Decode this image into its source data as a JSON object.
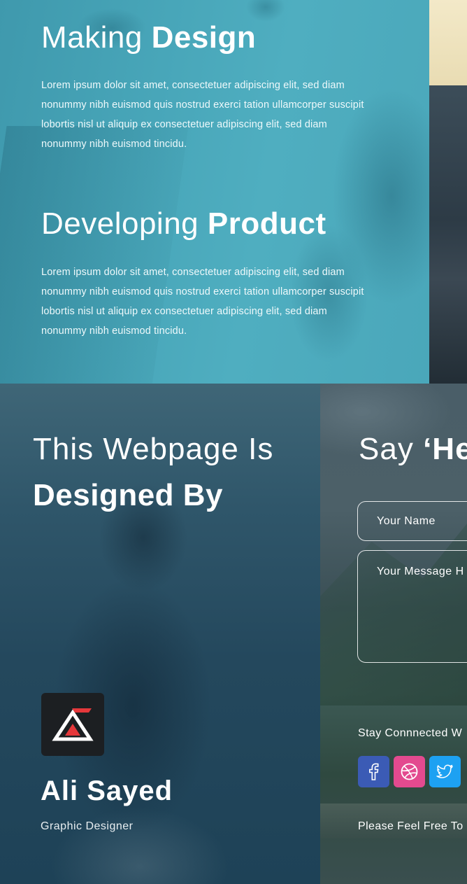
{
  "features": [
    {
      "heading_light": "Making",
      "heading_bold": "Design",
      "body": "Lorem ipsum dolor sit amet, consectetuer adipiscing elit, sed diam nonummy nibh euismod quis nostrud exerci tation ullamcorper suscipit lobortis nisl ut aliquip ex consectetuer adipiscing elit, sed diam nonummy nibh euismod tincidu."
    },
    {
      "heading_light": "Developing",
      "heading_bold": "Product",
      "body": "Lorem ipsum dolor sit amet, consectetuer adipiscing elit, sed diam nonummy nibh euismod quis nostrud exerci tation ullamcorper suscipit lobortis nisl ut aliquip ex consectetuer adipiscing elit, sed diam nonummy nibh euismod tincidu."
    }
  ],
  "designer": {
    "title_light": "This Webpage Is",
    "title_bold": "Designed By",
    "logo_icon": "triangle-logo-icon",
    "name": "Ali Sayed",
    "role": "Graphic Designer",
    "logo_colors": {
      "background": "#1c1f22",
      "accent": "#e5383b",
      "stroke": "#ffffff"
    }
  },
  "contact": {
    "title_light": "Say",
    "title_bold": "‘He",
    "name_placeholder": "Your Name",
    "message_placeholder": "Your Message H",
    "stay_connected": "Stay Connnected W",
    "feel_free": "Please Feel Free To",
    "social": [
      {
        "icon": "facebook-icon",
        "color": "#3b5bb5"
      },
      {
        "icon": "dribbble-icon",
        "color": "#e34a8f"
      },
      {
        "icon": "twitter-icon",
        "color": "#1da1f2"
      }
    ]
  }
}
